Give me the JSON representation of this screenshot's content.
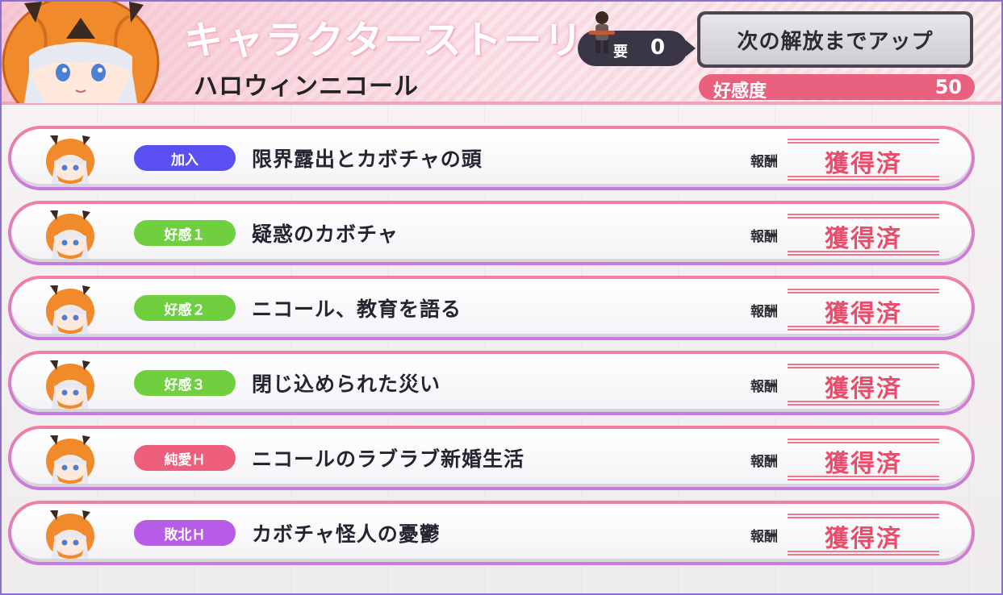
{
  "header": {
    "title_deco": "キャラクターストーリー",
    "character_name": "ハロウィンニコール",
    "requirement_label": "要",
    "requirement_value": "0",
    "next_unlock_button": "次の解放までアップ",
    "affinity_label": "好感度",
    "affinity_value": "50"
  },
  "colors": {
    "accent_pink": "#e9617f",
    "tag_join": "#5a4ff0",
    "tag_affinity": "#6fcf3f",
    "tag_pure_love": "#ee5f7e",
    "tag_defeat": "#b75ce6",
    "stamp_red": "#ea4d6b"
  },
  "rows": [
    {
      "tag": "加入",
      "tag_color": "#5a4ff0",
      "title": "限界露出とカボチャの頭",
      "reward_label": "報酬",
      "status": "獲得済"
    },
    {
      "tag": "好感１",
      "tag_color": "#6fcf3f",
      "title": "疑惑のカボチャ",
      "reward_label": "報酬",
      "status": "獲得済"
    },
    {
      "tag": "好感２",
      "tag_color": "#6fcf3f",
      "title": "ニコール、教育を語る",
      "reward_label": "報酬",
      "status": "獲得済"
    },
    {
      "tag": "好感３",
      "tag_color": "#6fcf3f",
      "title": "閉じ込められた災い",
      "reward_label": "報酬",
      "status": "獲得済"
    },
    {
      "tag": "純愛Ｈ",
      "tag_color": "#ee5f7e",
      "title": "ニコールのラブラブ新婚生活",
      "reward_label": "報酬",
      "status": "獲得済"
    },
    {
      "tag": "敗北Ｈ",
      "tag_color": "#b75ce6",
      "title": "カボチャ怪人の憂鬱",
      "reward_label": "報酬",
      "status": "獲得済"
    }
  ]
}
